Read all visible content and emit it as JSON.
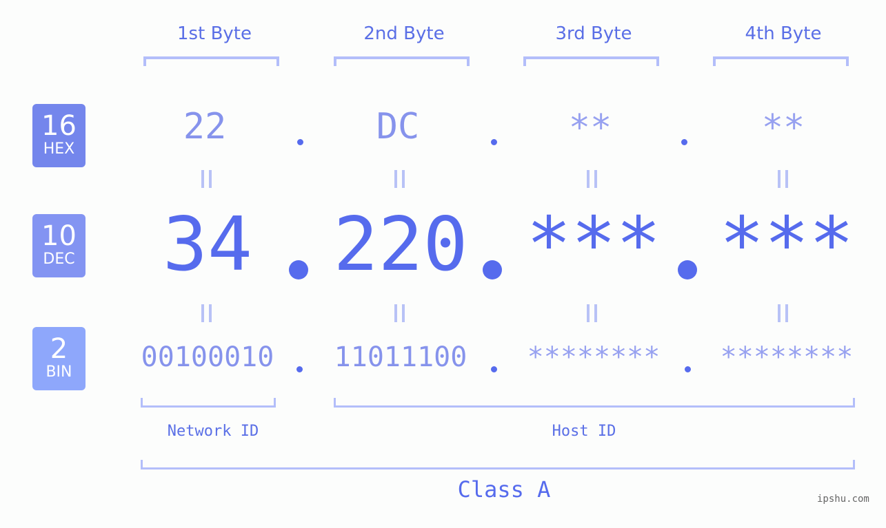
{
  "bytes": [
    {
      "label": "1st Byte",
      "hex": "22",
      "dec": "34",
      "bin": "00100010"
    },
    {
      "label": "2nd Byte",
      "hex": "DC",
      "dec": "220",
      "bin": "11011100"
    },
    {
      "label": "3rd Byte",
      "hex": "**",
      "dec": "***",
      "bin": "********"
    },
    {
      "label": "4th Byte",
      "hex": "**",
      "dec": "***",
      "bin": "********"
    }
  ],
  "badges": {
    "hex": {
      "base": "16",
      "name": "HEX",
      "color": "#7486ec"
    },
    "dec": {
      "base": "10",
      "name": "DEC",
      "color": "#8394f2"
    },
    "bin": {
      "base": "2",
      "name": "BIN",
      "color": "#8ea7fb"
    }
  },
  "labels": {
    "network_id": "Network ID",
    "host_id": "Host ID",
    "class": "Class A"
  },
  "watermark": "ipshu.com",
  "colors": {
    "accent": "#566bed",
    "bracket": "#b3befa",
    "equals": "#b8c2f6"
  }
}
